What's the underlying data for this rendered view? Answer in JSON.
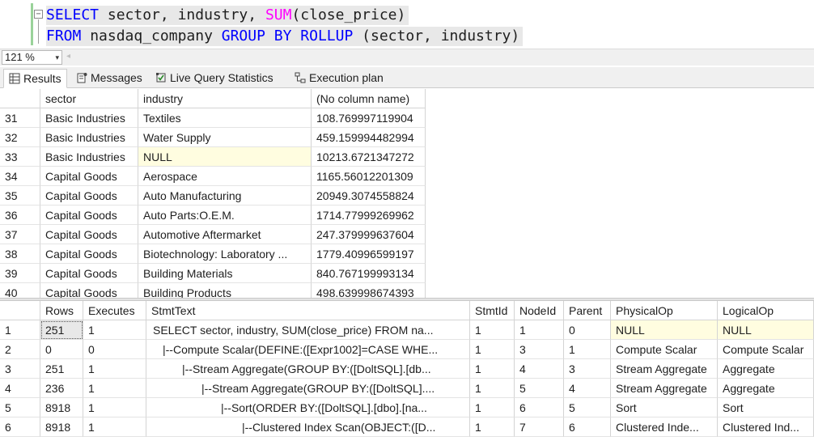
{
  "editor": {
    "line1": {
      "kw_select": "SELECT",
      "t1": " sector, industry, ",
      "fn": "SUM",
      "t2": "(close_price)"
    },
    "line2": {
      "kw_from": "FROM",
      "t1": " nasdaq_company ",
      "kw_group": "GROUP BY",
      "t2": " ",
      "kw_rollup": "ROLLUP",
      "t3": " (sector, industry)"
    },
    "fold_symbol": "−"
  },
  "zoom": {
    "value": "121 %",
    "arrow": "▾",
    "scroll_left": "◂"
  },
  "tabs": [
    {
      "label": "Results"
    },
    {
      "label": "Messages"
    },
    {
      "label": "Live Query Statistics"
    },
    {
      "label": "Execution plan"
    }
  ],
  "results": {
    "columns": [
      "sector",
      "industry",
      "(No column name)"
    ],
    "rows": [
      {
        "n": "31",
        "sector": "Basic Industries",
        "industry": "Textiles",
        "value": "108.769997119904"
      },
      {
        "n": "32",
        "sector": "Basic Industries",
        "industry": "Water Supply",
        "value": "459.159994482994"
      },
      {
        "n": "33",
        "sector": "Basic Industries",
        "industry": "NULL",
        "value": "10213.6721347272"
      },
      {
        "n": "34",
        "sector": "Capital Goods",
        "industry": "Aerospace",
        "value": "1165.56012201309"
      },
      {
        "n": "35",
        "sector": "Capital Goods",
        "industry": "Auto Manufacturing",
        "value": "20949.3074558824"
      },
      {
        "n": "36",
        "sector": "Capital Goods",
        "industry": "Auto Parts:O.E.M.",
        "value": "1714.77999269962"
      },
      {
        "n": "37",
        "sector": "Capital Goods",
        "industry": "Automotive Aftermarket",
        "value": "247.379999637604"
      },
      {
        "n": "38",
        "sector": "Capital Goods",
        "industry": "Biotechnology: Laboratory ...",
        "value": "1779.40996599197"
      },
      {
        "n": "39",
        "sector": "Capital Goods",
        "industry": "Building Materials",
        "value": "840.767199993134"
      },
      {
        "n": "40",
        "sector": "Capital Goods",
        "industry": "Building Products",
        "value": "498.639998674393"
      }
    ]
  },
  "stats": {
    "columns": [
      "Rows",
      "Executes",
      "StmtText",
      "StmtId",
      "NodeId",
      "Parent",
      "PhysicalOp",
      "LogicalOp"
    ],
    "rows": [
      {
        "n": "1",
        "rows": "251",
        "executes": "1",
        "stmt": "SELECT sector, industry, SUM(close_price)   FROM na...",
        "stmtid": "1",
        "nodeid": "1",
        "parent": "0",
        "phys": "NULL",
        "logical": "NULL"
      },
      {
        "n": "2",
        "rows": "0",
        "executes": "0",
        "stmt": "|--Compute Scalar(DEFINE:([Expr1002]=CASE WHE...",
        "stmtid": "1",
        "nodeid": "3",
        "parent": "1",
        "phys": "Compute Scalar",
        "logical": "Compute Scalar"
      },
      {
        "n": "3",
        "rows": "251",
        "executes": "1",
        "stmt": "|--Stream Aggregate(GROUP BY:([DoltSQL].[db...",
        "stmtid": "1",
        "nodeid": "4",
        "parent": "3",
        "phys": "Stream Aggregate",
        "logical": "Aggregate"
      },
      {
        "n": "4",
        "rows": "236",
        "executes": "1",
        "stmt": "|--Stream Aggregate(GROUP BY:([DoltSQL]....",
        "stmtid": "1",
        "nodeid": "5",
        "parent": "4",
        "phys": "Stream Aggregate",
        "logical": "Aggregate"
      },
      {
        "n": "5",
        "rows": "8918",
        "executes": "1",
        "stmt": "|--Sort(ORDER BY:([DoltSQL].[dbo].[na...",
        "stmtid": "1",
        "nodeid": "6",
        "parent": "5",
        "phys": "Sort",
        "logical": "Sort"
      },
      {
        "n": "6",
        "rows": "8918",
        "executes": "1",
        "stmt": "|--Clustered Index Scan(OBJECT:([D...",
        "stmtid": "1",
        "nodeid": "7",
        "parent": "6",
        "phys": "Clustered Inde...",
        "logical": "Clustered Ind..."
      }
    ]
  },
  "colors": {
    "keyword": "#0000ff",
    "function": "#ff00ff",
    "null_cell": "#fffde0"
  }
}
